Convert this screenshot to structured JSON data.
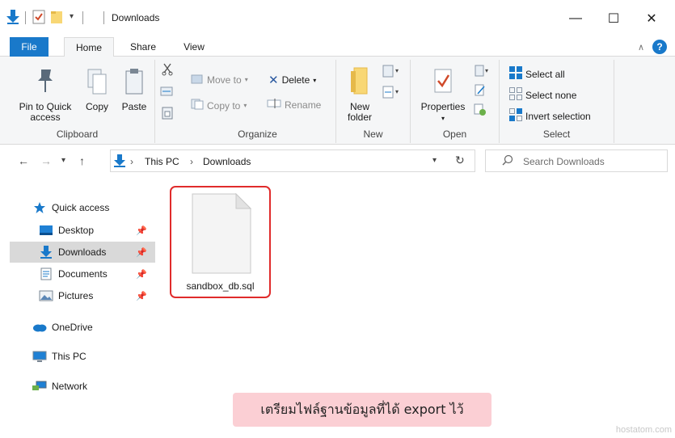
{
  "window": {
    "title": "Downloads",
    "minimize": "—",
    "maximize": "☐",
    "close": "✕"
  },
  "ribbon_tabs": {
    "file": "File",
    "home": "Home",
    "share": "Share",
    "view": "View",
    "help": "?"
  },
  "ribbon": {
    "clipboard": {
      "label": "Clipboard",
      "pin_line1": "Pin to Quick",
      "pin_line2": "access",
      "copy": "Copy",
      "paste": "Paste"
    },
    "organize": {
      "label": "Organize",
      "move_to": "Move to",
      "copy_to": "Copy to",
      "delete": "Delete",
      "rename": "Rename"
    },
    "new": {
      "label": "New",
      "new_folder_line1": "New",
      "new_folder_line2": "folder"
    },
    "open": {
      "label": "Open",
      "properties": "Properties"
    },
    "select": {
      "label": "Select",
      "select_all": "Select all",
      "select_none": "Select none",
      "invert": "Invert selection"
    }
  },
  "address": {
    "crumbs": [
      "This PC",
      "Downloads"
    ],
    "separator": "›",
    "search_placeholder": "Search Downloads"
  },
  "nav": {
    "items": [
      {
        "label": "Quick access",
        "icon": "star-icon"
      },
      {
        "label": "Desktop",
        "icon": "desktop-icon",
        "pinned": true
      },
      {
        "label": "Downloads",
        "icon": "downloads-icon",
        "pinned": true,
        "selected": true
      },
      {
        "label": "Documents",
        "icon": "documents-icon",
        "pinned": true
      },
      {
        "label": "Pictures",
        "icon": "pictures-icon",
        "pinned": true
      },
      {
        "label": "OneDrive",
        "icon": "cloud-icon"
      },
      {
        "label": "This PC",
        "icon": "computer-icon"
      },
      {
        "label": "Network",
        "icon": "network-icon"
      }
    ]
  },
  "files": [
    {
      "name": "sandbox_db.sql"
    }
  ],
  "caption": "เตรียมไฟล์ฐานข้อมูลที่ได้ export ไว้",
  "watermark": "hostatom.com",
  "colors": {
    "accent": "#1979ca",
    "highlight_border": "#e02b2b",
    "caption_bg": "#fbcfd4",
    "selected_bg": "#d9d9d9"
  }
}
